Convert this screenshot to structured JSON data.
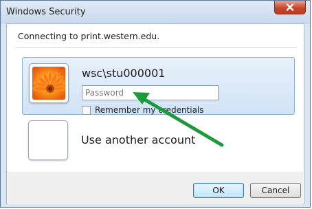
{
  "window": {
    "title": "Windows Security",
    "close_icon": "close-icon"
  },
  "message": {
    "connecting": "Connecting to print.western.edu."
  },
  "credential": {
    "username": "wsc\\stu000001",
    "password_placeholder": "Password",
    "password_value": "",
    "remember_label": "Remember my credentials",
    "remember_checked": false,
    "user_tile_icon": "flower-user-tile-icon"
  },
  "other_account": {
    "label": "Use another account",
    "tile_icon": "blank-user-tile-icon"
  },
  "buttons": {
    "ok": "OK",
    "cancel": "Cancel"
  },
  "annotation": {
    "arrow_icon": "green-arrow-icon",
    "arrow_color": "#1a9a3a"
  },
  "colors": {
    "selection_border": "#8fb2de",
    "close_button": "#c8452c"
  }
}
